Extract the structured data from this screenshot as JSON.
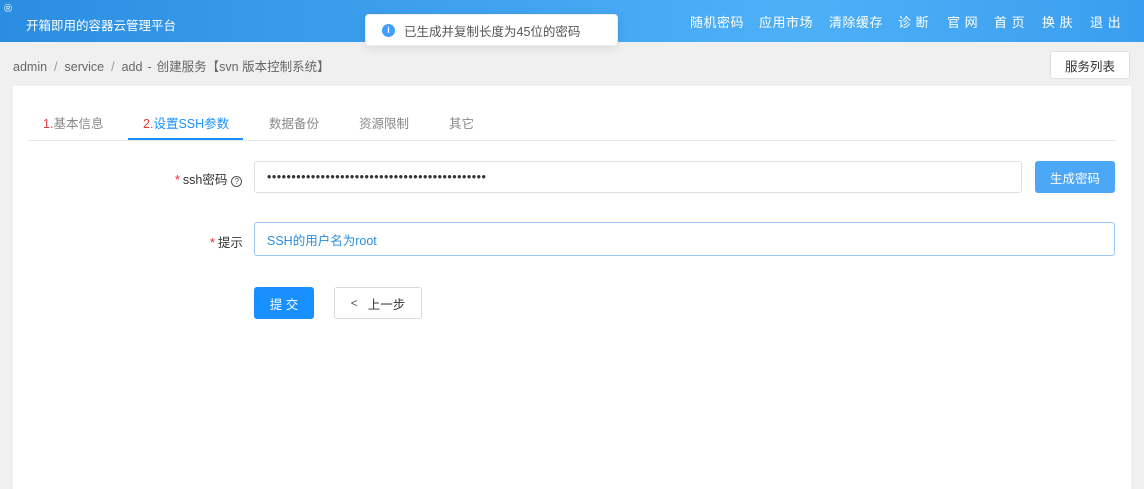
{
  "header": {
    "reg_mark": "®",
    "title": "开箱即用的容器云管理平台",
    "nav": [
      {
        "label": "随机密码"
      },
      {
        "label": "应用市场"
      },
      {
        "label": "清除缓存"
      },
      {
        "label": "诊 断"
      },
      {
        "label": "官 网"
      },
      {
        "label": "首 页"
      },
      {
        "label": "换 肤"
      },
      {
        "label": "退 出"
      }
    ]
  },
  "toast": {
    "icon": "info-icon",
    "icon_glyph": "i",
    "message": "已生成并复制长度为45位的密码"
  },
  "breadcrumb": {
    "items": [
      "admin",
      "service",
      "add"
    ],
    "separator": "/",
    "dash": "-",
    "current": "创建服务【svn 版本控制系统】"
  },
  "service_list_button": "服务列表",
  "tabs": [
    {
      "num": "1.",
      "label": "基本信息",
      "active": false
    },
    {
      "num": "2.",
      "label": "设置SSH参数",
      "active": true
    },
    {
      "num": "",
      "label": "数据备份",
      "active": false
    },
    {
      "num": "",
      "label": "资源限制",
      "active": false
    },
    {
      "num": "",
      "label": "其它",
      "active": false
    }
  ],
  "form": {
    "ssh_password": {
      "required_mark": "*",
      "label": "ssh密码",
      "help_glyph": "?",
      "value": "•••••••••••••••••••••••••••••••••••••••••••••"
    },
    "generate_button": "生成密码",
    "hint": {
      "required_mark": "*",
      "label": "提示",
      "value": "SSH的用户名为root"
    },
    "submit_button": "提 交",
    "prev_button": "上一步",
    "prev_glyph": "<"
  },
  "colors": {
    "primary": "#1890ff",
    "header_blue": "#3fa2f0",
    "required": "#f5222d",
    "tab_number": "#e03c3c"
  }
}
